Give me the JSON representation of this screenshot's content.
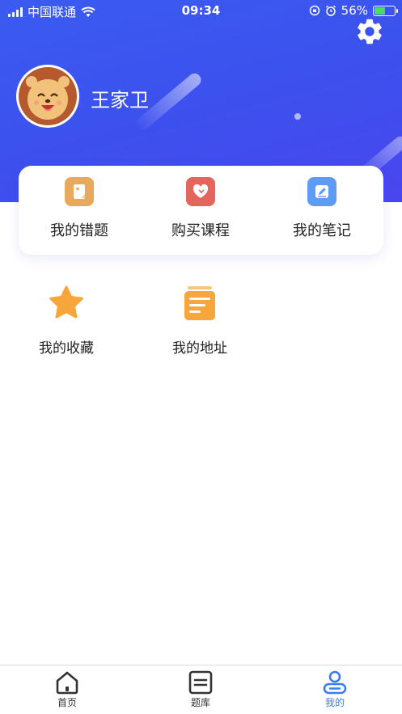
{
  "status_bar": {
    "carrier": "中国联通",
    "time": "09:34",
    "battery": "56%",
    "battery_level": 0.56
  },
  "profile": {
    "username": "王家卫"
  },
  "card_items": [
    {
      "label": "我的错题",
      "icon": "wrong-questions-icon",
      "color": "#e8a95f"
    },
    {
      "label": "购买课程",
      "icon": "heart-icon",
      "color": "#e4655c"
    },
    {
      "label": "我的笔记",
      "icon": "note-edit-icon",
      "color": "#5e9bf4"
    }
  ],
  "tools": [
    {
      "label": "我的收藏",
      "icon": "star-icon",
      "color": "#f7a63b"
    },
    {
      "label": "我的地址",
      "icon": "list-doc-icon",
      "color": "#f7a63b"
    }
  ],
  "tabs": [
    {
      "label": "首页",
      "icon": "home-icon"
    },
    {
      "label": "题库",
      "icon": "question-bank-icon"
    },
    {
      "label": "我的",
      "icon": "profile-icon",
      "active": true
    }
  ],
  "colors": {
    "header": "#3d50ee",
    "active_tab": "#3b7cf0"
  }
}
